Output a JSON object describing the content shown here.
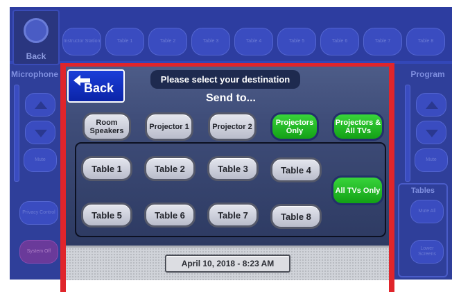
{
  "background": {
    "back_label": "Back",
    "top_tabs": [
      "Instructor Station",
      "Table 1",
      "Table 2",
      "Table 3",
      "Table 4",
      "Table 5",
      "Table 6",
      "Table 7",
      "Table 8"
    ],
    "left_panel": {
      "title": "Microphone",
      "mute": "Mute",
      "privacy": "Privacy Control",
      "system_off": "System Off"
    },
    "right_panel": {
      "title": "Program",
      "mute": "Mute",
      "tables_title": "Tables",
      "mute_all": "Mute All",
      "lower_screens": "Lower Screens"
    }
  },
  "popup": {
    "back_label": "Back",
    "prompt": "Please select your destination",
    "send_to": "Send to...",
    "destinations": [
      {
        "label": "Room Speakers",
        "style": "grey"
      },
      {
        "label": "Projector 1",
        "style": "grey"
      },
      {
        "label": "Projector 2",
        "style": "grey"
      },
      {
        "label": "Projectors Only",
        "style": "green"
      },
      {
        "label": "Projectors & All TVs",
        "style": "green"
      }
    ],
    "tables": [
      "Table 1",
      "Table 2",
      "Table 3",
      "Table 4",
      "Table 5",
      "Table 6",
      "Table 7",
      "Table 8"
    ],
    "all_tvs_label": "All TVs Only",
    "date_time": "April 10, 2018  -  8:23 AM"
  },
  "colors": {
    "frame": "#e0252b",
    "accent_green": "#1fb522",
    "back_blue": "#1433c4"
  }
}
